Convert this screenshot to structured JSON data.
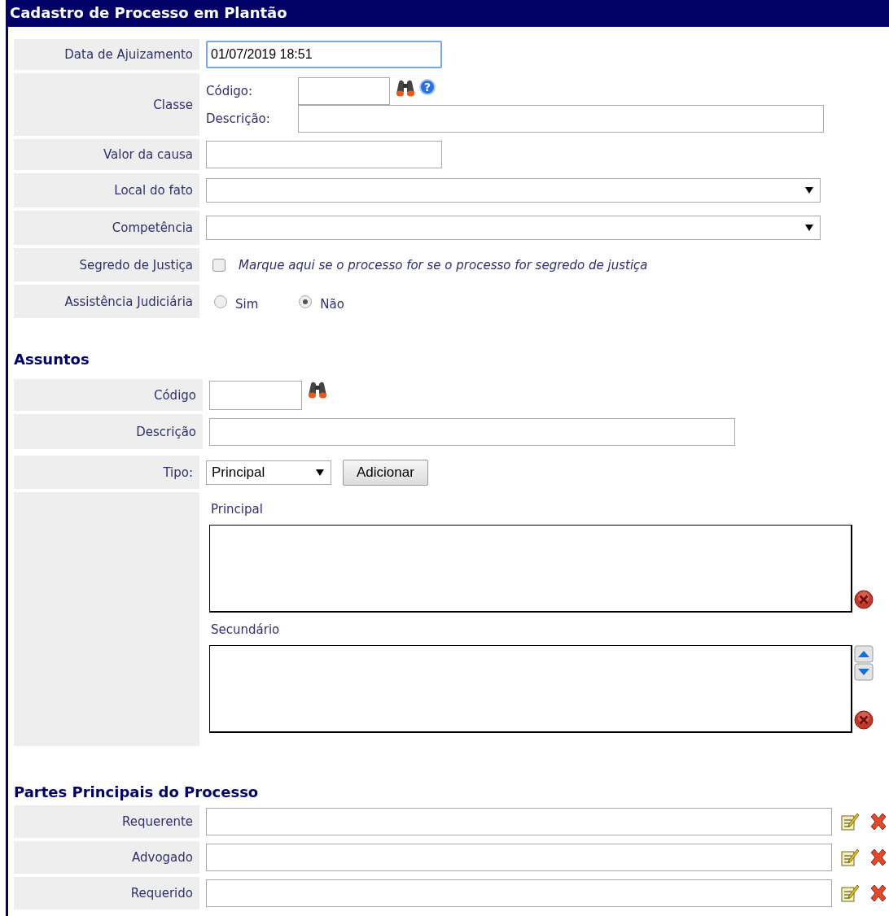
{
  "title": "Cadastro de Processo em Plantão",
  "fields": [
    {
      "kind": "text",
      "label": "Data de Ajuizamento",
      "value": "01/07/2019 18:51",
      "focused": true
    },
    {
      "kind": "classe",
      "label": "Classe",
      "code_label": "Código:",
      "desc_label": "Descrição:",
      "help": "?"
    },
    {
      "kind": "text",
      "label": "Valor da causa",
      "focused": false
    },
    {
      "kind": "select",
      "label": "Local do fato"
    },
    {
      "kind": "select",
      "label": "Competência"
    },
    {
      "kind": "checkbox",
      "label": "Segredo de Justiça",
      "checked": false,
      "hint": "Marque aqui se o processo for se o processo for segredo de justiça"
    },
    {
      "kind": "radio",
      "label": "Assistência Judiciária",
      "options": [
        {
          "label": "Sim",
          "selected": false
        },
        {
          "label": "Não",
          "selected": true
        }
      ]
    }
  ],
  "assuntos": {
    "heading": "Assuntos",
    "code_label": "Código",
    "desc_label": "Descrição",
    "type_label": "Tipo:",
    "type_value": "Principal",
    "add_button": "Adicionar",
    "lists": [
      {
        "kind": "plain",
        "label": "Principal"
      },
      {
        "kind": "reorderable",
        "label": "Secundário"
      }
    ]
  },
  "partes": {
    "heading": "Partes Principais do Processo",
    "rows": [
      {
        "label": "Requerente"
      },
      {
        "label": "Advogado"
      },
      {
        "label": "Requerido"
      }
    ]
  }
}
